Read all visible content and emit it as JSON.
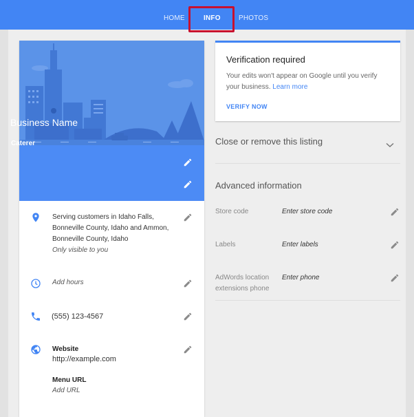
{
  "nav": {
    "tabs": [
      {
        "label": "HOME"
      },
      {
        "label": "INFO"
      },
      {
        "label": "PHOTOS"
      }
    ],
    "active": "INFO"
  },
  "colors": {
    "brand_blue": "#4285f4",
    "highlight_red": "#c8102e"
  },
  "business": {
    "name": "Business Name",
    "category": "Caterer",
    "service_area_lines": [
      "Serving customers in Idaho Falls,",
      "Bonneville County, Idaho and Ammon,",
      "Bonneville County, Idaho"
    ],
    "service_area_note": "Only visible to you",
    "hours": "Add hours",
    "phone": "(555) 123-4567",
    "website_label": "Website",
    "website": "http://example.com",
    "menu_label": "Menu URL",
    "menu_value": "Add URL"
  },
  "verification": {
    "title": "Verification required",
    "body": "Your edits won't appear on Google until you verify your business.",
    "link": "Learn more",
    "button": "VERIFY NOW"
  },
  "close_listing": {
    "label": "Close or remove this listing"
  },
  "advanced": {
    "title": "Advanced information",
    "fields": [
      {
        "label": "Store code",
        "value": "Enter store code"
      },
      {
        "label": "Labels",
        "value": "Enter labels"
      },
      {
        "label_lines": [
          "AdWords location",
          "extensions phone"
        ],
        "value": "Enter phone"
      }
    ]
  }
}
